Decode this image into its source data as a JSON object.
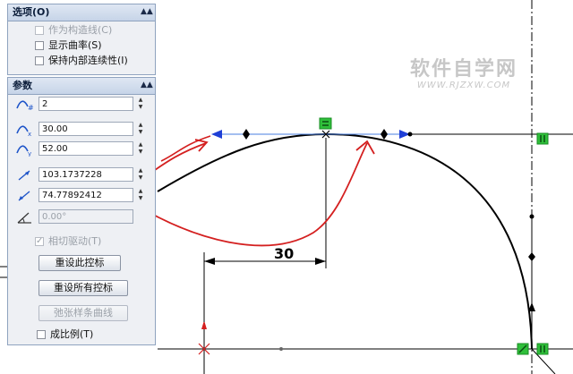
{
  "options_panel": {
    "title": "选项(O)",
    "items": [
      {
        "label": "作为构造线(C)",
        "checked": false,
        "enabled": false
      },
      {
        "label": "显示曲率(S)",
        "checked": false,
        "enabled": true
      },
      {
        "label": "保持内部连续性(I)",
        "checked": false,
        "enabled": true
      }
    ]
  },
  "params_panel": {
    "title": "参数",
    "fields": [
      {
        "name": "spline-point-number",
        "value": "2",
        "icon": "spline-point-icon"
      },
      {
        "name": "x-coordinate",
        "value": "30.00",
        "icon": "x-coordinate-icon"
      },
      {
        "name": "y-coordinate",
        "value": "52.00",
        "icon": "y-coordinate-icon"
      },
      {
        "name": "tangent-weight-1",
        "value": "103.1737228",
        "icon": "tangent-weight-icon"
      },
      {
        "name": "tangent-weight-2",
        "value": "74.77892412",
        "icon": "tangent-weight-icon"
      },
      {
        "name": "tangent-angle",
        "value": "0.00°",
        "icon": "tangent-angle-icon"
      }
    ],
    "tangent_driving": {
      "label": "相切驱动(T)",
      "checked": true,
      "enabled": false
    },
    "buttons": {
      "reset_this": "重设此控标",
      "reset_all": "重设所有控标",
      "relax_spline": "弛张样条曲线"
    },
    "proportional": {
      "label": "成比例(T)",
      "checked": false
    }
  },
  "watermark": {
    "title": "软件自学网",
    "url": "WWW.RJZXW.COM"
  },
  "sketch": {
    "dimension_value": "30"
  },
  "colors": {
    "annotation_red": "#d42020",
    "relation_green": "#2fbf3a",
    "handle_blue": "#1f3fd6",
    "panel_border": "#8fa3bf"
  }
}
